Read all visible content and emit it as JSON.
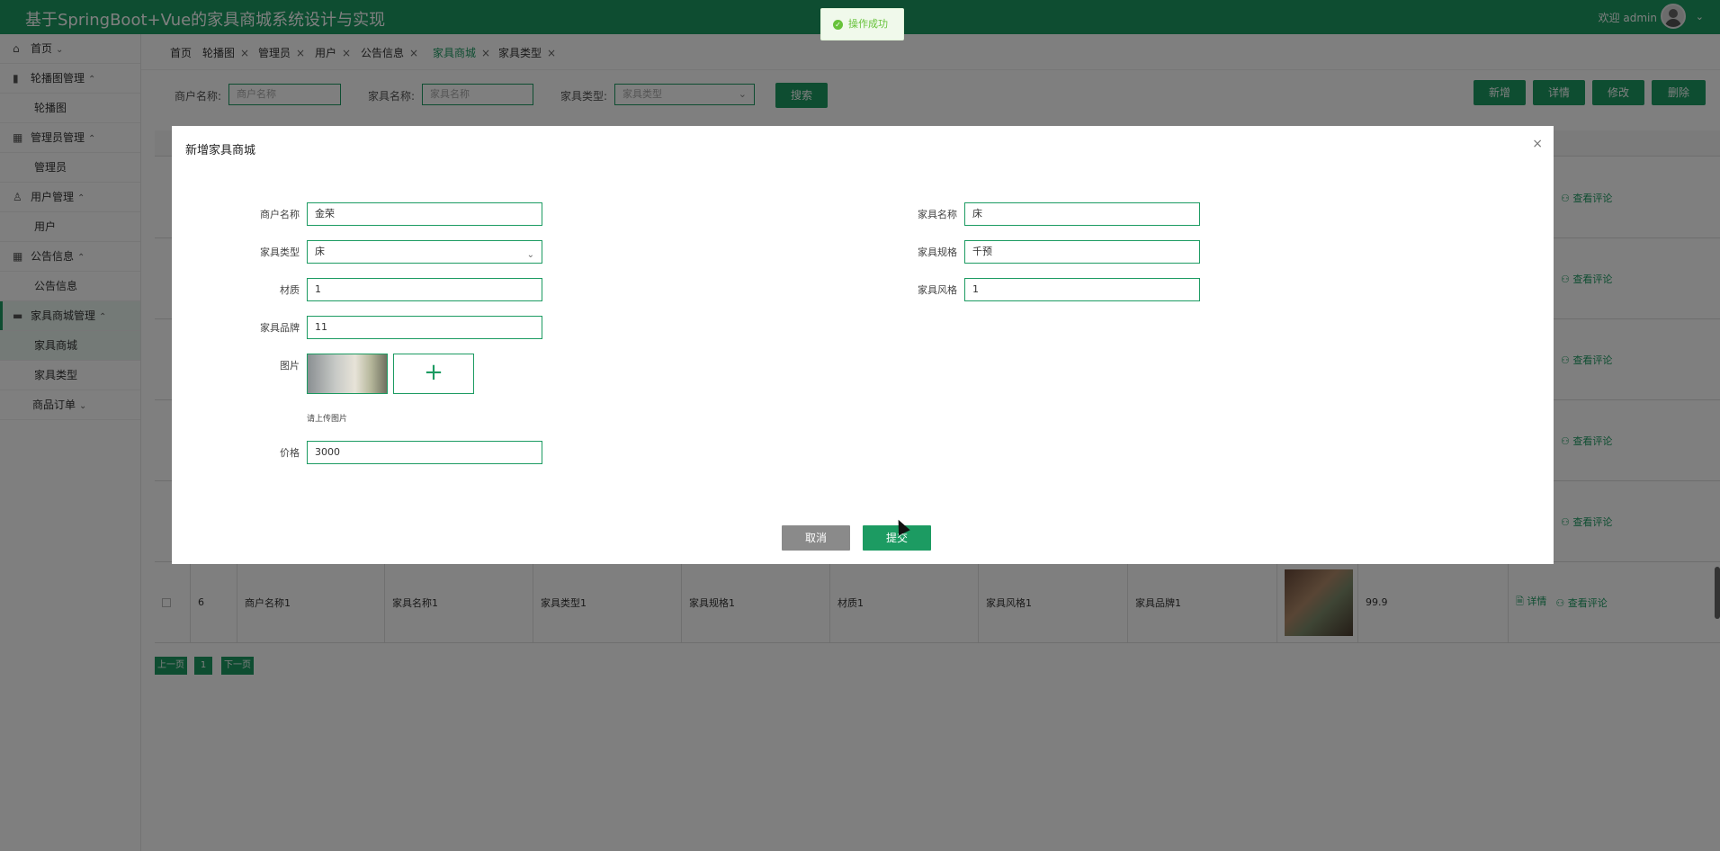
{
  "header": {
    "title": "基于SpringBoot+Vue的家具商城系统设计与实现",
    "welcome": "欢迎 admin"
  },
  "sidebar": {
    "items": [
      {
        "label": "首页",
        "icon": "home-icon"
      },
      {
        "label": "轮播图管理",
        "icon": "carousel-icon",
        "sub": "轮播图"
      },
      {
        "label": "管理员管理",
        "icon": "grid-icon",
        "sub": "管理员"
      },
      {
        "label": "用户管理",
        "icon": "user-icon",
        "sub": "用户"
      },
      {
        "label": "公告信息",
        "icon": "grid-icon",
        "sub": "公告信息"
      },
      {
        "label": "家具商城管理",
        "icon": "shop-icon",
        "subs": [
          "家具商城",
          "家具类型"
        ]
      },
      {
        "label": "商品订单"
      }
    ]
  },
  "tabs": [
    "首页",
    "轮播图",
    "管理员",
    "用户",
    "公告信息",
    "家具商城",
    "家具类型"
  ],
  "search": {
    "merchant_label": "商户名称:",
    "merchant_placeholder": "商户名称",
    "name_label": "家具名称:",
    "name_placeholder": "家具名称",
    "type_label": "家具类型:",
    "type_placeholder": "家具类型",
    "search_button": "搜索"
  },
  "actions": {
    "add": "新增",
    "detail": "详情",
    "edit": "修改",
    "delete": "删除"
  },
  "table": {
    "review_link": "查看评论",
    "detail_link": "详情",
    "last_row": {
      "index": "6",
      "merchant": "商户名称1",
      "name": "家具名称1",
      "type": "家具类型1",
      "spec": "家具规格1",
      "material": "材质1",
      "style": "家具风格1",
      "brand": "家具品牌1",
      "price": "99.9"
    }
  },
  "pager": {
    "prev": "上一页",
    "page": "1",
    "next": "下一页"
  },
  "toast": {
    "text": "操作成功"
  },
  "dialog": {
    "title": "新增家具商城",
    "merchant_label": "商户名称",
    "merchant_value": "金荣",
    "name_label": "家具名称",
    "name_value": "床",
    "type_label": "家具类型",
    "type_value": "床",
    "spec_label": "家具规格",
    "spec_value": "千预",
    "material_label": "材质",
    "material_value": "1",
    "style_label": "家具风格",
    "style_value": "1",
    "brand_label": "家具品牌",
    "brand_value": "11",
    "image_label": "图片",
    "upload_tip": "请上传图片",
    "price_label": "价格",
    "price_value": "3000",
    "cancel": "取消",
    "submit": "提交"
  },
  "colors": {
    "primary": "#1c9b62",
    "toast": "#67c23a",
    "cancel": "#8a8a8a"
  }
}
